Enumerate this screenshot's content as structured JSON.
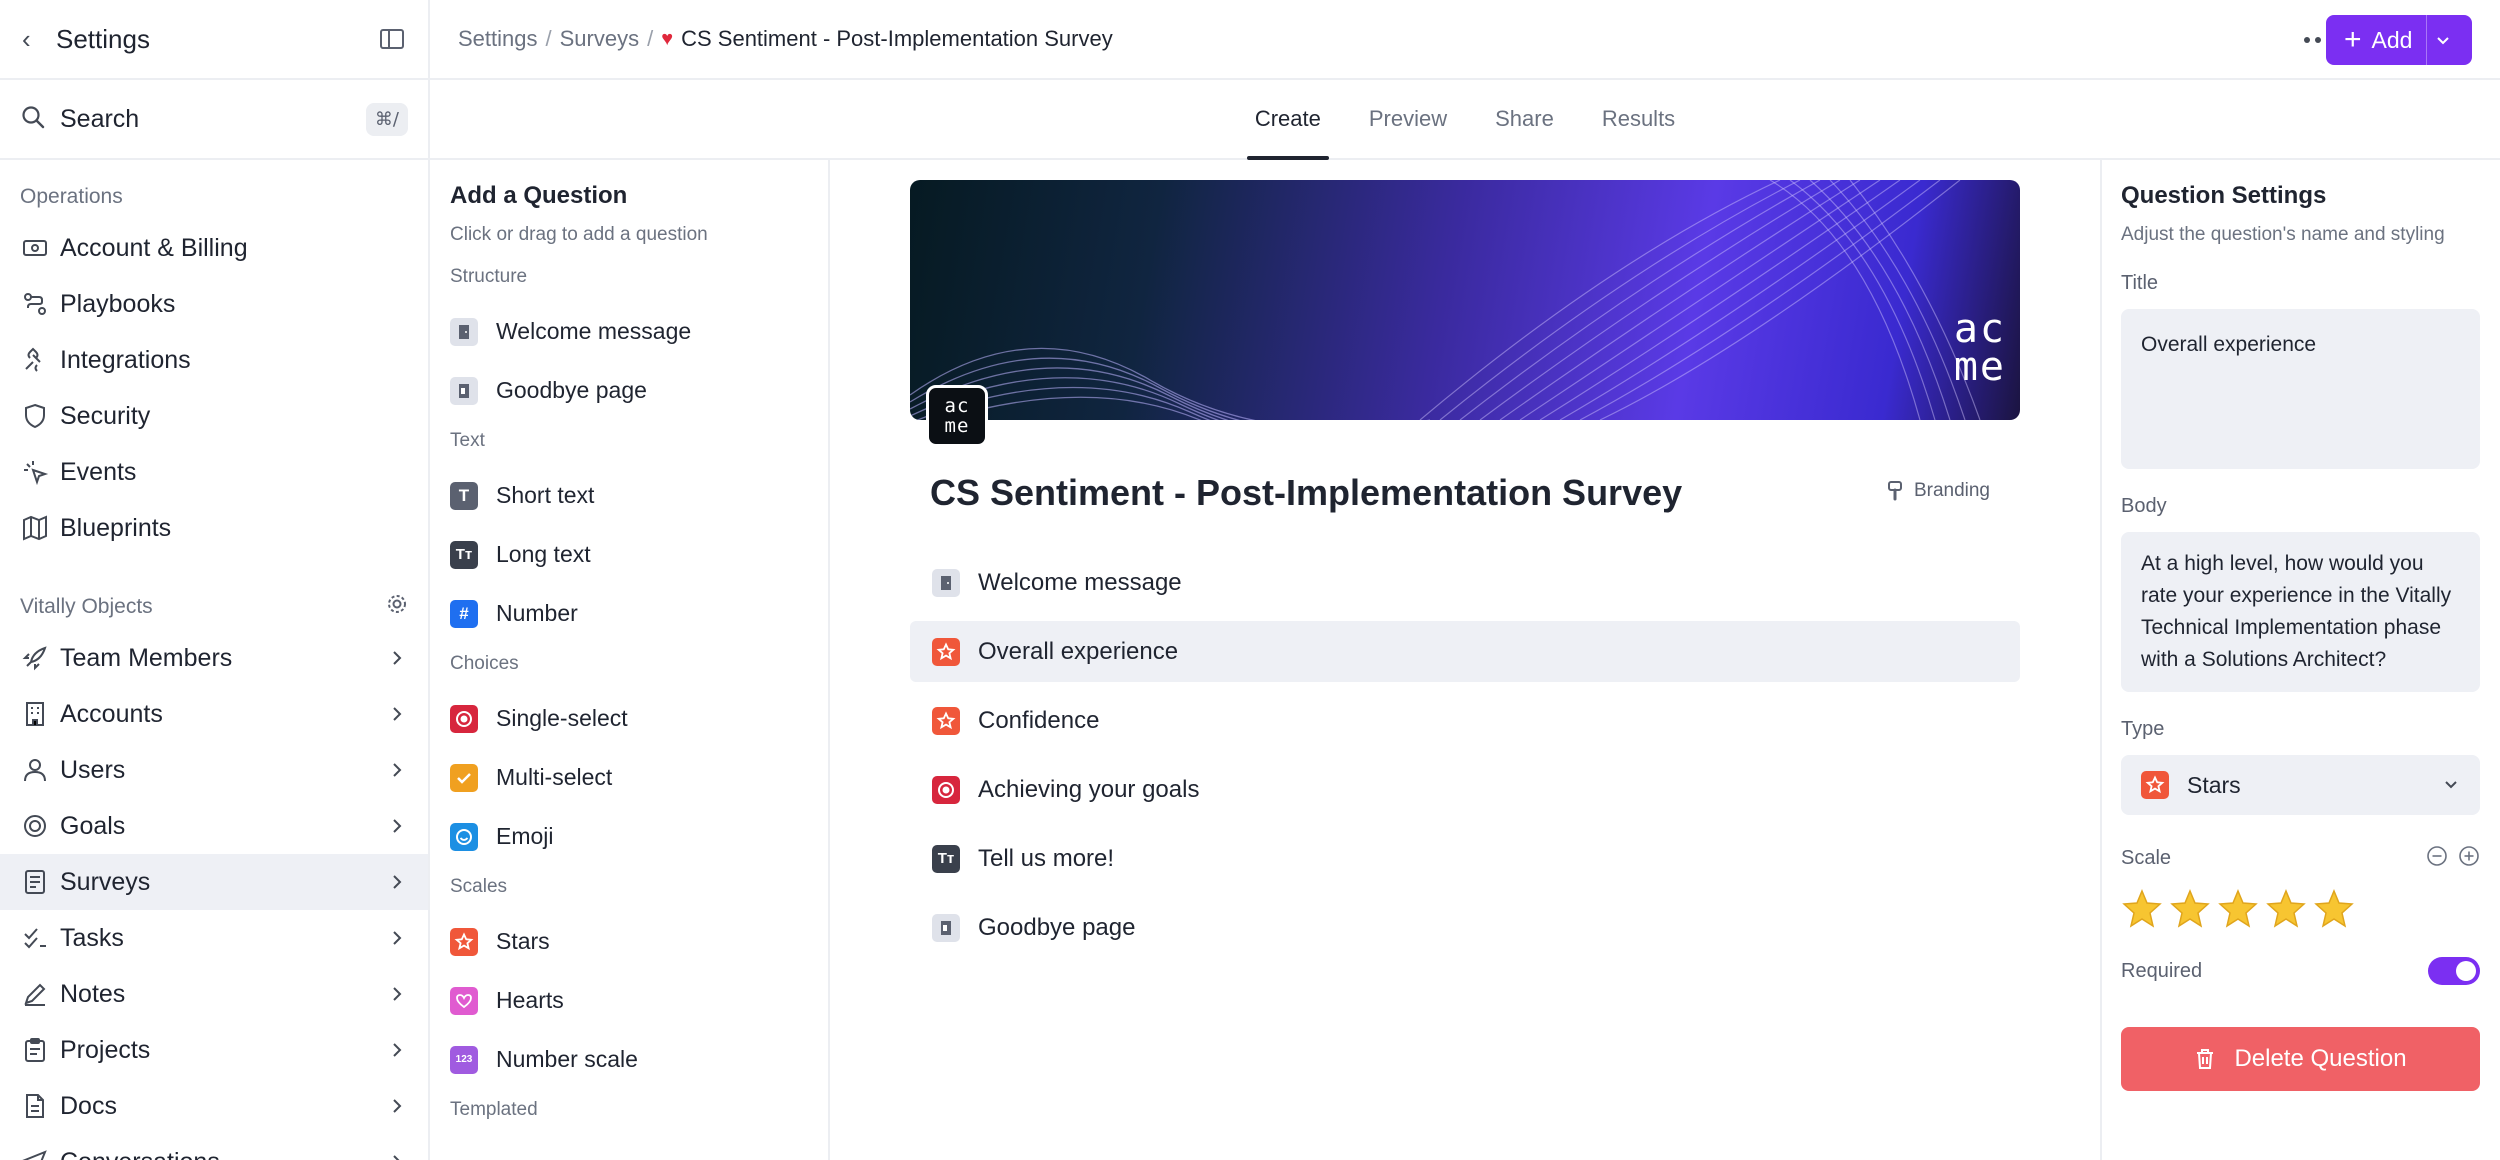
{
  "sidebar": {
    "title": "Settings",
    "search_label": "Search",
    "search_shortcut": "⌘/",
    "group_operations": "Operations",
    "operations": [
      {
        "label": "Account & Billing",
        "icon": "billing-icon"
      },
      {
        "label": "Playbooks",
        "icon": "playbooks-icon"
      },
      {
        "label": "Integrations",
        "icon": "integrations-icon"
      },
      {
        "label": "Security",
        "icon": "shield-icon"
      },
      {
        "label": "Events",
        "icon": "events-icon"
      },
      {
        "label": "Blueprints",
        "icon": "map-icon"
      }
    ],
    "group_objects": "Vitally Objects",
    "objects": [
      {
        "label": "Team Members",
        "icon": "rocket-icon"
      },
      {
        "label": "Accounts",
        "icon": "building-icon"
      },
      {
        "label": "Users",
        "icon": "user-icon"
      },
      {
        "label": "Goals",
        "icon": "goal-icon"
      },
      {
        "label": "Surveys",
        "icon": "survey-icon"
      },
      {
        "label": "Tasks",
        "icon": "tasks-icon"
      },
      {
        "label": "Notes",
        "icon": "pen-icon"
      },
      {
        "label": "Projects",
        "icon": "clipboard-icon"
      },
      {
        "label": "Docs",
        "icon": "doc-icon"
      },
      {
        "label": "Conversations",
        "icon": "conversation-icon"
      }
    ]
  },
  "topbar": {
    "crumb_1": "Settings",
    "crumb_2": "Surveys",
    "current": "CS Sentiment - Post-Implementation Survey",
    "add_label": "Add"
  },
  "tabs": [
    "Create",
    "Preview",
    "Share",
    "Results"
  ],
  "add_question": {
    "title": "Add a Question",
    "subtitle": "Click or drag to add a question",
    "groups": {
      "structure": "Structure",
      "text": "Text",
      "choices": "Choices",
      "scales": "Scales",
      "templated": "Templated"
    },
    "items": {
      "welcome": "Welcome message",
      "goodbye": "Goodbye page",
      "short_text": "Short text",
      "long_text": "Long text",
      "number": "Number",
      "single_select": "Single-select",
      "multi_select": "Multi-select",
      "emoji": "Emoji",
      "stars": "Stars",
      "hearts": "Hearts",
      "number_scale": "Number scale"
    }
  },
  "survey": {
    "banner_logo_line1": "ac",
    "banner_logo_line2": "me",
    "title": "CS Sentiment - Post-Implementation Survey",
    "branding_label": "Branding",
    "questions": [
      "Welcome message",
      "Overall experience",
      "Confidence",
      "Achieving your goals",
      "Tell us more!",
      "Goodbye page"
    ]
  },
  "settings": {
    "title": "Question Settings",
    "subtitle": "Adjust the question's name and styling",
    "title_label": "Title",
    "title_value": "Overall experience",
    "body_label": "Body",
    "body_value": "At a high level, how would you rate your experience in the Vitally Technical Implementation phase with a Solutions Architect?",
    "type_label": "Type",
    "type_value": "Stars",
    "scale_label": "Scale",
    "scale_value": 5,
    "required_label": "Required",
    "required_value": true,
    "delete_label": "Delete Question"
  },
  "colors": {
    "accent": "#7b2ff2",
    "danger": "#f06166",
    "stars_icon": "#f0573a",
    "select_icon": "#d7263d",
    "multi_icon": "#f0a020",
    "emoji_icon": "#1c8fe3",
    "number_icon": "#1f6ff0",
    "hearts_icon": "#e05bd0",
    "scale_icon": "#a05be0"
  }
}
